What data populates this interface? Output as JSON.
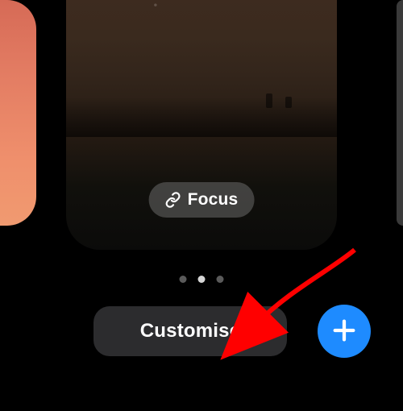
{
  "previews": {
    "left_sliver": {
      "gradient_start": "#d66a56",
      "gradient_end": "#f09a70"
    },
    "center": {
      "focus_label": "Focus",
      "focus_icon": "link-icon"
    },
    "right_sliver": {
      "color": "#3a3a3a"
    }
  },
  "page_dots": {
    "count": 3,
    "active_index": 1
  },
  "buttons": {
    "customise_label": "Customise",
    "add_icon": "plus-icon"
  },
  "annotation": {
    "arrow_color": "#ff0000"
  }
}
